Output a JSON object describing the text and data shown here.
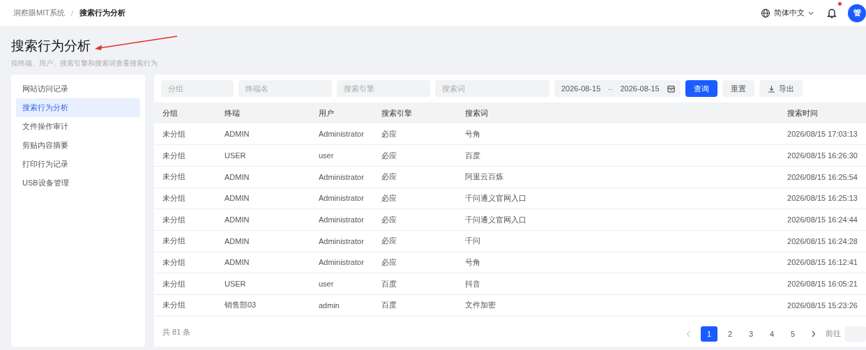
{
  "breadcrumb_separator": "/",
  "breadcrumb": [
    {
      "label": "洞察眼MIT系统",
      "current": false
    },
    {
      "label": "搜索行为分析",
      "current": true
    }
  ],
  "header": {
    "language": "简体中文",
    "notification_dot": true,
    "avatar": "管"
  },
  "page": {
    "title": "搜索行为分析",
    "subtitle": "按终端、用户、搜索引擎和搜索词查看搜索行为"
  },
  "sidebar": {
    "items": [
      {
        "label": "网站访问记录",
        "selected": false
      },
      {
        "label": "搜索行为分析",
        "selected": true
      },
      {
        "label": "文件操作审计",
        "selected": false
      },
      {
        "label": "剪贴内容摘要",
        "selected": false
      },
      {
        "label": "打印行为记录",
        "selected": false
      },
      {
        "label": "USB设备管理",
        "selected": false
      }
    ]
  },
  "filters": {
    "fields": [
      {
        "placeholder": "分组",
        "kind": "short"
      },
      {
        "placeholder": "终端名",
        "kind": "medium"
      },
      {
        "placeholder": "搜索引擎",
        "kind": "medium"
      },
      {
        "placeholder": "搜索词",
        "kind": "long"
      }
    ],
    "date_range": {
      "start": "2026-08-15",
      "separator": "–",
      "end": "2026-08-15"
    },
    "buttons": [
      {
        "label": "查询",
        "kind": "primary"
      },
      {
        "label": "重置",
        "kind": "plain"
      },
      {
        "label": "导出",
        "kind": "download"
      }
    ]
  },
  "table": {
    "columns": [
      "分组",
      "终端",
      "用户",
      "搜索引擎",
      "搜索词",
      "搜索时间"
    ],
    "rows": [
      [
        "未分组",
        "ADMIN",
        "Administrator",
        "必应",
        "号角",
        "2026/08/15 17:03:13"
      ],
      [
        "未分组",
        "USER",
        "user",
        "必应",
        "百度",
        "2026/08/15 16:26:30"
      ],
      [
        "未分组",
        "ADMIN",
        "Administrator",
        "必应",
        "阿里云百炼",
        "2026/08/15 16:25:54"
      ],
      [
        "未分组",
        "ADMIN",
        "Administrator",
        "必应",
        "千问通义官网入口",
        "2026/08/15 16:25:13"
      ],
      [
        "未分组",
        "ADMIN",
        "Administrator",
        "必应",
        "千问通义官网入口",
        "2026/08/15 16:24:44"
      ],
      [
        "未分组",
        "ADMIN",
        "Administrator",
        "必应",
        "千问",
        "2026/08/15 16:24:28"
      ],
      [
        "未分组",
        "ADMIN",
        "Administrator",
        "必应",
        "号角",
        "2026/08/15 16:12:41"
      ],
      [
        "未分组",
        "USER",
        "user",
        "百度",
        "抖音",
        "2026/08/15 16:05:21"
      ],
      [
        "未分组",
        "销售部03",
        "admin",
        "百度",
        "文件加密",
        "2026/08/15 15:23:26"
      ]
    ]
  },
  "pagination": {
    "total": "共 81 条",
    "prev_disabled": true,
    "pages": [
      {
        "label": "1",
        "selected": true
      },
      {
        "label": "2",
        "selected": false
      },
      {
        "label": "3",
        "selected": false
      },
      {
        "label": "4",
        "selected": false
      },
      {
        "label": "5",
        "selected": false
      }
    ],
    "goto_label": "前往"
  }
}
